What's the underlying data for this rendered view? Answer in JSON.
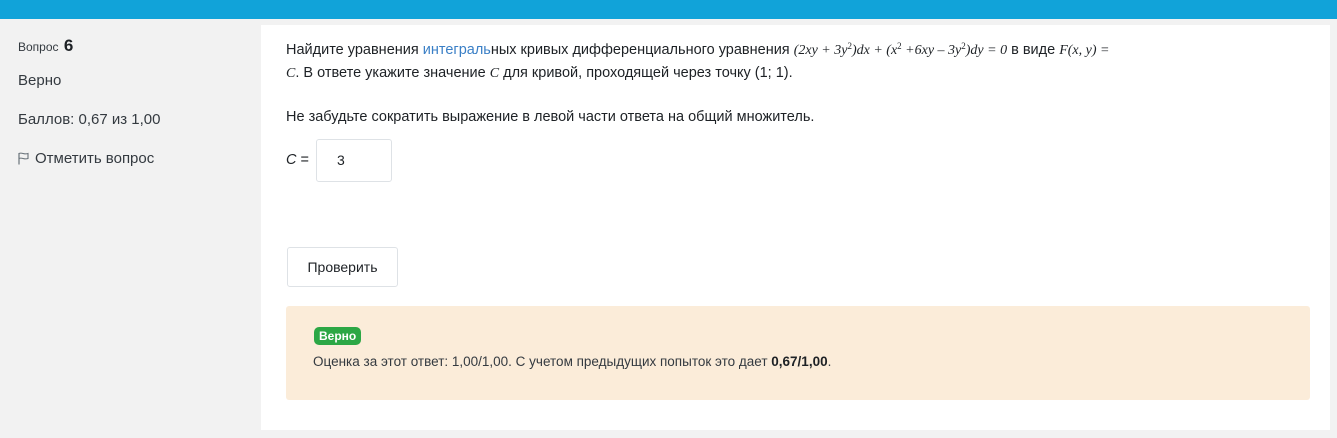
{
  "question": {
    "number_label": "Вопрос",
    "number": "6",
    "state": "Верно",
    "grade": "Баллов: 0,67 из 1,00",
    "flag_label": "Отметить вопрос",
    "flag_icon": "flag-icon"
  },
  "text": {
    "part1": "Найдите уравнения ",
    "part1_hl": "интеграль",
    "part2": "ных кривых дифференциального уравнения ",
    "eq_a": "(2xy + 3y",
    "eq_a2": ")dx + (x",
    "eq_a3": " +6xy – 3y",
    "eq_a4": ")dy = 0",
    "sup2": "2",
    "part3": " в виде ",
    "eq_f": "F(x, y) =",
    "eq_c1": "C",
    "part4": ". В ответе укажите значение ",
    "eq_c2": "C",
    "part5": " для кривой, проходящей через точку (1; 1).",
    "note": "Не забудьте сократить выражение в левой части ответа на общий множитель."
  },
  "answer": {
    "label": "C",
    "eq": " =",
    "value": "3"
  },
  "buttons": {
    "check": "Проверить"
  },
  "feedback": {
    "badge": "Верно",
    "text": "Оценка за этот ответ: 1,00/1,00. С учетом предыдущих попыток это дает ",
    "bold": "0,67/1,00",
    "end": "."
  },
  "colors": {
    "topbar": "#11a3d9",
    "badge": "#2ca745",
    "feedback_bg": "#fbecd9",
    "link": "#3a7fc6"
  }
}
